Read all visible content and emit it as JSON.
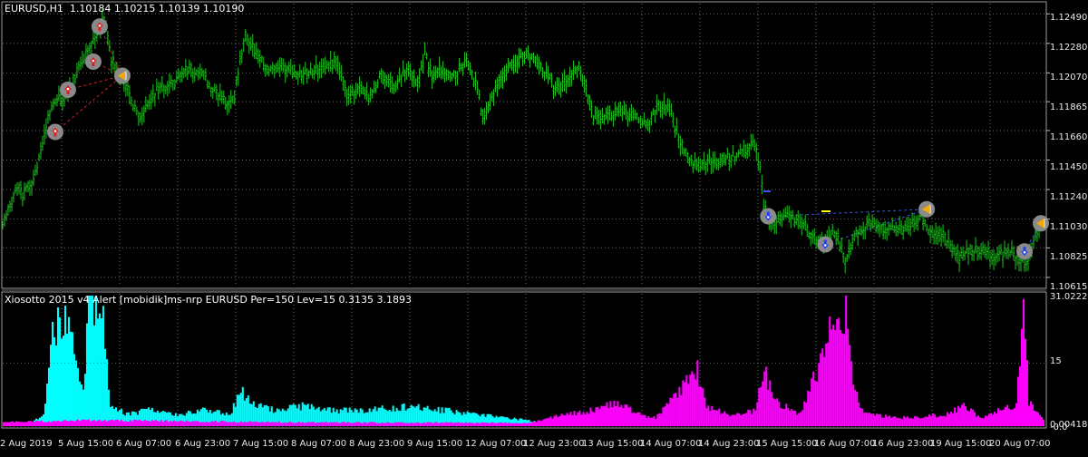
{
  "window": {
    "price_title": "EURUSD,H1  1.10184 1.10215 1.10139 1.10190",
    "indicator_title": "Xiosotto 2015 v4 Alert [mobidik]ms-nrp EURUSD Per=150 Lev=15 0.3135 3.1893"
  },
  "price_axis": {
    "labels": [
      "1.12490",
      "1.12280",
      "1.12070",
      "1.11865",
      "1.11660",
      "1.11450",
      "1.11240",
      "1.11030",
      "1.10825",
      "1.10615"
    ]
  },
  "indicator_axis": {
    "labels": [
      "31.0222",
      "15",
      "0.00418",
      "-0.0"
    ]
  },
  "time_axis": {
    "labels": [
      "2 Aug 2019",
      "5 Aug 15:00",
      "6 Aug 07:00",
      "6 Aug 23:00",
      "7 Aug 15:00",
      "8 Aug 07:00",
      "8 Aug 23:00",
      "9 Aug 15:00",
      "12 Aug 07:00",
      "12 Aug 23:00",
      "13 Aug 15:00",
      "14 Aug 07:00",
      "14 Aug 23:00",
      "15 Aug 15:00",
      "16 Aug 07:00",
      "16 Aug 23:00",
      "19 Aug 15:00",
      "20 Aug 07:00"
    ]
  },
  "colors": {
    "background": "#000000",
    "bar_up": "#22c022",
    "grid": "#6a6a6a",
    "histogram_bull": "#00ffff",
    "histogram_bear": "#ff00ff",
    "signal_line": "#3355ff",
    "signal_red": "#cc2222",
    "marker_ring": "#8a8a8a"
  },
  "chart_data": [
    {
      "type": "candlestick",
      "title": "EURUSD,H1",
      "ylim": [
        1.1055,
        1.1255
      ],
      "anchors": [
        [
          0,
          1.11
        ],
        [
          16,
          1.1125
        ],
        [
          22,
          1.112
        ],
        [
          34,
          1.113
        ],
        [
          42,
          1.115
        ],
        [
          54,
          1.1185
        ],
        [
          70,
          1.119
        ],
        [
          84,
          1.121
        ],
        [
          100,
          1.123
        ],
        [
          112,
          1.1245
        ],
        [
          120,
          1.1215
        ],
        [
          128,
          1.1205
        ],
        [
          136,
          1.12
        ],
        [
          144,
          1.1185
        ],
        [
          152,
          1.1175
        ],
        [
          160,
          1.1185
        ],
        [
          170,
          1.1195
        ],
        [
          190,
          1.12
        ],
        [
          205,
          1.121
        ],
        [
          220,
          1.1205
        ],
        [
          232,
          1.1195
        ],
        [
          246,
          1.1185
        ],
        [
          256,
          1.119
        ],
        [
          262,
          1.1215
        ],
        [
          268,
          1.1235
        ],
        [
          276,
          1.1225
        ],
        [
          290,
          1.121
        ],
        [
          310,
          1.121
        ],
        [
          330,
          1.1205
        ],
        [
          350,
          1.121
        ],
        [
          368,
          1.1215
        ],
        [
          380,
          1.119
        ],
        [
          392,
          1.1195
        ],
        [
          405,
          1.119
        ],
        [
          418,
          1.1205
        ],
        [
          432,
          1.1195
        ],
        [
          446,
          1.121
        ],
        [
          458,
          1.12
        ],
        [
          466,
          1.122
        ],
        [
          474,
          1.1205
        ],
        [
          486,
          1.121
        ],
        [
          500,
          1.1205
        ],
        [
          512,
          1.1215
        ],
        [
          524,
          1.1195
        ],
        [
          530,
          1.1175
        ],
        [
          540,
          1.119
        ],
        [
          552,
          1.1205
        ],
        [
          566,
          1.1215
        ],
        [
          580,
          1.122
        ],
        [
          596,
          1.121
        ],
        [
          610,
          1.1195
        ],
        [
          624,
          1.12
        ],
        [
          636,
          1.1215
        ],
        [
          644,
          1.1195
        ],
        [
          652,
          1.1175
        ],
        [
          664,
          1.1175
        ],
        [
          680,
          1.118
        ],
        [
          696,
          1.1175
        ],
        [
          712,
          1.117
        ],
        [
          724,
          1.1185
        ],
        [
          736,
          1.118
        ],
        [
          744,
          1.1165
        ],
        [
          752,
          1.115
        ],
        [
          766,
          1.114
        ],
        [
          780,
          1.1145
        ],
        [
          798,
          1.1145
        ],
        [
          814,
          1.115
        ],
        [
          830,
          1.1155
        ],
        [
          836,
          1.114
        ],
        [
          840,
          1.111
        ],
        [
          850,
          1.11
        ],
        [
          866,
          1.1105
        ],
        [
          882,
          1.11
        ],
        [
          896,
          1.109
        ],
        [
          906,
          1.1085
        ],
        [
          918,
          1.1095
        ],
        [
          930,
          1.1075
        ],
        [
          940,
          1.109
        ],
        [
          956,
          1.11
        ],
        [
          970,
          1.1095
        ],
        [
          990,
          1.1095
        ],
        [
          1006,
          1.11
        ],
        [
          1014,
          1.1105
        ],
        [
          1024,
          1.1095
        ],
        [
          1040,
          1.109
        ],
        [
          1056,
          1.1075
        ],
        [
          1068,
          1.108
        ],
        [
          1084,
          1.108
        ],
        [
          1096,
          1.1075
        ],
        [
          1110,
          1.108
        ],
        [
          1124,
          1.1075
        ],
        [
          1130,
          1.107
        ],
        [
          1140,
          1.109
        ],
        [
          1148,
          1.11
        ]
      ],
      "signal_markers": [
        {
          "type": "up-arrow",
          "price": 1.1165
        },
        {
          "type": "up-arrow",
          "price": 1.1195
        },
        {
          "type": "up-arrow",
          "price": 1.1215
        },
        {
          "type": "up-arrow",
          "price": 1.124
        },
        {
          "type": "exit-flag",
          "price": 1.1205
        },
        {
          "type": "down-arrow",
          "price": 1.1105
        },
        {
          "type": "down-arrow",
          "price": 1.1085
        },
        {
          "type": "exit-flag",
          "price": 1.111
        },
        {
          "type": "down-arrow",
          "price": 1.108
        },
        {
          "type": "exit-flag",
          "price": 1.11
        }
      ]
    },
    {
      "type": "bar",
      "title": "Xiosotto 2015 v4 Alert [mobidik]ms-nrp EURUSD Per=150 Lev=15",
      "ylim": [
        -0.0,
        31.0222
      ],
      "levels": [
        15,
        0.00418
      ],
      "series": [
        {
          "color": "#00ffff",
          "segments": [
            [
              0,
              0.3
            ],
            [
              30,
              0.8
            ],
            [
              45,
              3
            ],
            [
              55,
              24
            ],
            [
              62,
              25
            ],
            [
              75,
              26
            ],
            [
              82,
              16
            ],
            [
              88,
              10
            ],
            [
              94,
              29
            ],
            [
              102,
              31
            ],
            [
              108,
              30
            ],
            [
              118,
              6
            ],
            [
              125,
              4
            ],
            [
              140,
              3
            ],
            [
              160,
              4
            ],
            [
              180,
              3
            ],
            [
              200,
              3
            ],
            [
              220,
              4
            ],
            [
              250,
              3
            ],
            [
              262,
              9
            ],
            [
              275,
              6
            ],
            [
              300,
              4
            ],
            [
              330,
              5
            ],
            [
              360,
              4
            ],
            [
              400,
              4
            ],
            [
              450,
              5
            ],
            [
              520,
              3
            ],
            [
              560,
              2
            ],
            [
              590,
              1
            ],
            [
              620,
              0.8
            ],
            [
              650,
              0
            ]
          ]
        },
        {
          "color": "#ff00ff",
          "segments": [
            [
              0,
              1
            ],
            [
              100,
              1.5
            ],
            [
              300,
              1
            ],
            [
              580,
              0.8
            ],
            [
              600,
              2
            ],
            [
              650,
              4
            ],
            [
              680,
              6
            ],
            [
              700,
              3
            ],
            [
              720,
              2
            ],
            [
              744,
              8
            ],
            [
              756,
              12
            ],
            [
              766,
              14
            ],
            [
              776,
              5
            ],
            [
              800,
              3
            ],
            [
              830,
              4
            ],
            [
              840,
              14
            ],
            [
              852,
              6
            ],
            [
              880,
              3
            ],
            [
              905,
              18
            ],
            [
              920,
              28
            ],
            [
              930,
              29
            ],
            [
              938,
              10
            ],
            [
              950,
              3
            ],
            [
              1000,
              2
            ],
            [
              1040,
              3
            ],
            [
              1060,
              5
            ],
            [
              1080,
              2
            ],
            [
              1100,
              4
            ],
            [
              1118,
              5
            ],
            [
              1126,
              29
            ],
            [
              1132,
              6
            ],
            [
              1148,
              2
            ]
          ]
        }
      ]
    }
  ]
}
